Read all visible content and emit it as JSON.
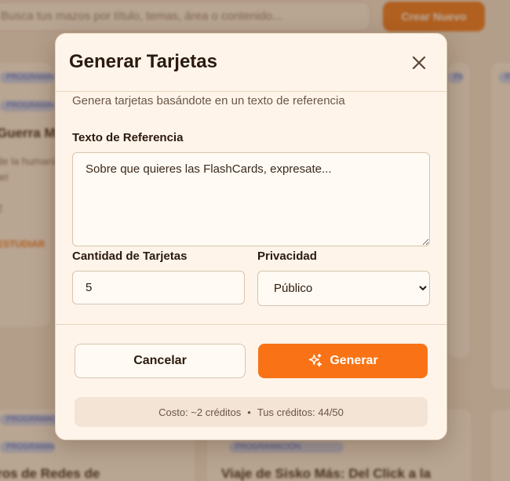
{
  "background": {
    "search_placeholder": "Busca tus mazos por título, temas, área o contenido...",
    "create_button": "Crear Nuevo",
    "cards": [
      {
        "tag": "PROGRAMACIÓN",
        "title": "Guerra Mu",
        "lines": [
          "de la humanidad",
          "ari"
        ],
        "extra": "2"
      },
      {
        "tag": "PROGRAMACIÓN",
        "title": "ros de Redes de",
        "lines": []
      },
      {
        "tag": "PROGRAMACIÓN",
        "title": "Viaje de Sisko Más: Del Click a la",
        "lines": []
      }
    ]
  },
  "modal": {
    "title": "Generar Tarjetas",
    "subtitle": "Genera tarjetas basándote en un texto de referencia",
    "reference_label": "Texto de Referencia",
    "reference_placeholder": "Sobre que quieres las FlashCards, expresate...",
    "quantity_label": "Cantidad de Tarjetas",
    "quantity_value": "5",
    "privacy_label": "Privacidad",
    "privacy_selected": "Público",
    "cancel_label": "Cancelar",
    "generate_label": "Generar",
    "cost_text": "Costo: ~2 créditos",
    "credits_text": "Tus créditos: 44/50",
    "separator": "•"
  },
  "colors": {
    "accent": "#f97316",
    "modal_bg": "#fef4ea",
    "overlay": "#5a3c1e"
  }
}
